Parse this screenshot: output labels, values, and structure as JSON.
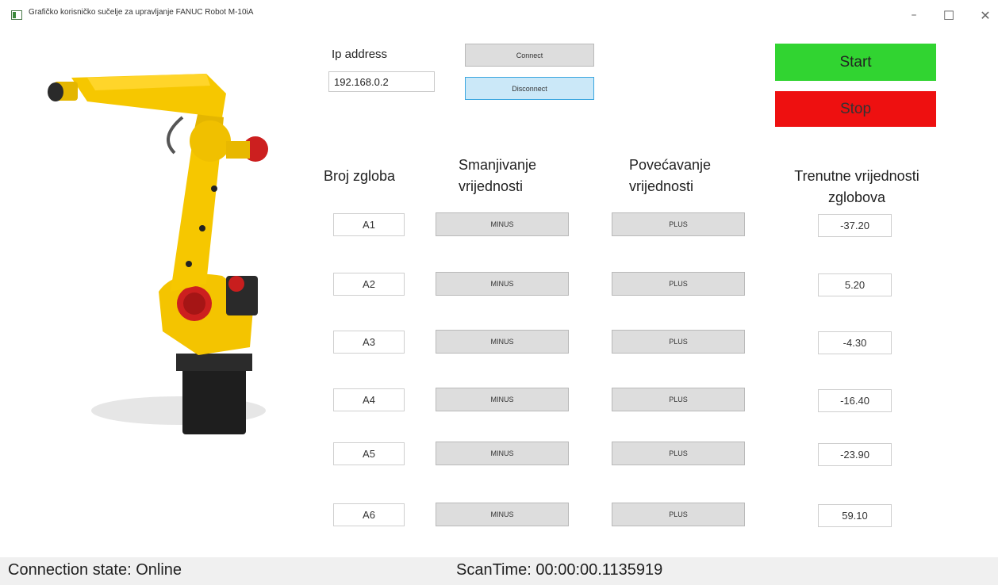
{
  "window": {
    "title": "Grafičko korisničko sučelje za upravljanje FANUC Robot M-10iA",
    "minimize_glyph": "–",
    "maximize_glyph": "☐",
    "close_glyph": "✕"
  },
  "connection": {
    "ip_label": "Ip address",
    "ip_value": "192.168.0.2",
    "connect_label": "Connect",
    "disconnect_label": "Disconnect"
  },
  "controls": {
    "start_label": "Start",
    "stop_label": "Stop",
    "start_color": "#31d431",
    "stop_color": "#ee1010"
  },
  "headers": {
    "joint_number": "Broj zgloba",
    "decrease_line1": "Smanjivanje",
    "decrease_line2": "vrijednosti",
    "increase_line1": "Povećavanje",
    "increase_line2": "vrijednosti",
    "current_line1": "Trenutne vrijednosti",
    "current_line2": "zglobova"
  },
  "joints": [
    {
      "name": "A1",
      "minus": "MINUS",
      "plus": "PLUS",
      "value": "-37.20"
    },
    {
      "name": "A2",
      "minus": "MINUS",
      "plus": "PLUS",
      "value": "5.20"
    },
    {
      "name": "A3",
      "minus": "MINUS",
      "plus": "PLUS",
      "value": "-4.30"
    },
    {
      "name": "A4",
      "minus": "MINUS",
      "plus": "PLUS",
      "value": "-16.40"
    },
    {
      "name": "A5",
      "minus": "MINUS",
      "plus": "PLUS",
      "value": "-23.90"
    },
    {
      "name": "A6",
      "minus": "MINUS",
      "plus": "PLUS",
      "value": "59.10"
    }
  ],
  "status": {
    "connection_state": "Connection state: Online",
    "scan_time": "ScanTime: 00:00:00.1135919"
  }
}
